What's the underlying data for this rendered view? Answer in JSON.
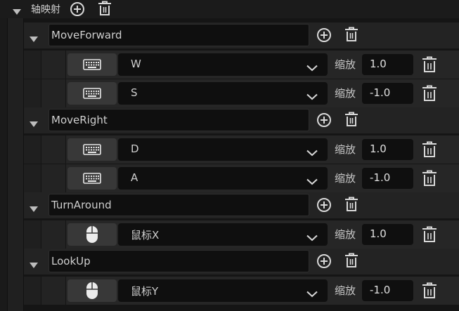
{
  "section": {
    "title": "轴映射",
    "add_icon": "plus-circle-icon",
    "delete_icon": "trash-icon"
  },
  "axis_mappings": [
    {
      "name": "MoveForward",
      "bindings": [
        {
          "device_icon": "keyboard-icon",
          "key": "W",
          "scale_label": "缩放",
          "scale": "1.0"
        },
        {
          "device_icon": "keyboard-icon",
          "key": "S",
          "scale_label": "缩放",
          "scale": "-1.0"
        }
      ]
    },
    {
      "name": "MoveRight",
      "bindings": [
        {
          "device_icon": "keyboard-icon",
          "key": "D",
          "scale_label": "缩放",
          "scale": "1.0"
        },
        {
          "device_icon": "keyboard-icon",
          "key": "A",
          "scale_label": "缩放",
          "scale": "-1.0"
        }
      ]
    },
    {
      "name": "TurnAround",
      "bindings": [
        {
          "device_icon": "mouse-icon",
          "key": "鼠标X",
          "scale_label": "缩放",
          "scale": "1.0"
        }
      ]
    },
    {
      "name": "LookUp",
      "bindings": [
        {
          "device_icon": "mouse-icon",
          "key": "鼠标Y",
          "scale_label": "缩放",
          "scale": "-1.0"
        }
      ]
    }
  ]
}
